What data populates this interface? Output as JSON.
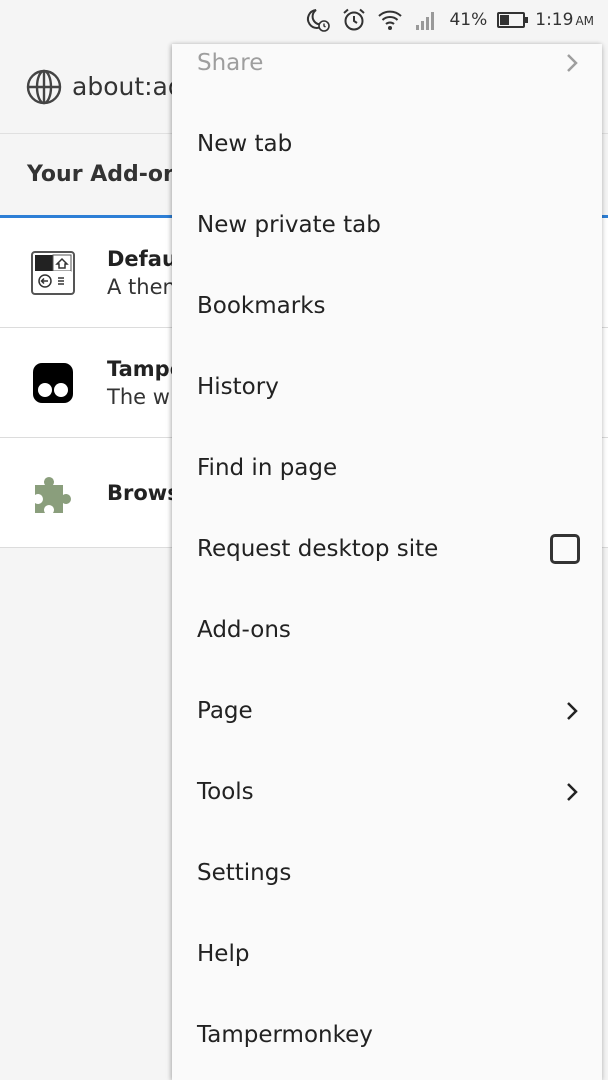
{
  "status_bar": {
    "icons": [
      "moon-alarm-icon",
      "alarm-clock-icon",
      "wifi-icon",
      "signal-icon"
    ],
    "battery_percent": "41%",
    "battery_level": 0.41,
    "time": "1:19",
    "ampm": "AM"
  },
  "toolbar": {
    "url": "about:ad",
    "icon": "globe-icon"
  },
  "addons": {
    "header": "Your Add-on",
    "items": [
      {
        "name": "Defaul",
        "desc": "A then",
        "icon": "theme-icon"
      },
      {
        "name": "Tampe",
        "desc": "The w",
        "icon": "tampermonkey-icon"
      },
      {
        "name": "Brows",
        "desc": "",
        "icon": "puzzle-piece-icon"
      }
    ]
  },
  "menu": {
    "items": [
      {
        "label": "Share",
        "disabled": true,
        "trailing": "chevron-right-icon"
      },
      {
        "label": "New tab"
      },
      {
        "label": "New private tab"
      },
      {
        "label": "Bookmarks"
      },
      {
        "label": "History"
      },
      {
        "label": "Find in page"
      },
      {
        "label": "Request desktop site",
        "trailing": "checkbox",
        "checked": false
      },
      {
        "label": "Add-ons"
      },
      {
        "label": "Page",
        "trailing": "chevron-right-icon"
      },
      {
        "label": "Tools",
        "trailing": "chevron-right-icon"
      },
      {
        "label": "Settings"
      },
      {
        "label": "Help"
      },
      {
        "label": "Tampermonkey"
      }
    ]
  },
  "colors": {
    "accent": "#2e7fd6",
    "menu_bg": "#fafafa",
    "disabled_text": "#9e9e9e",
    "puzzle": "#8a9e7c"
  }
}
